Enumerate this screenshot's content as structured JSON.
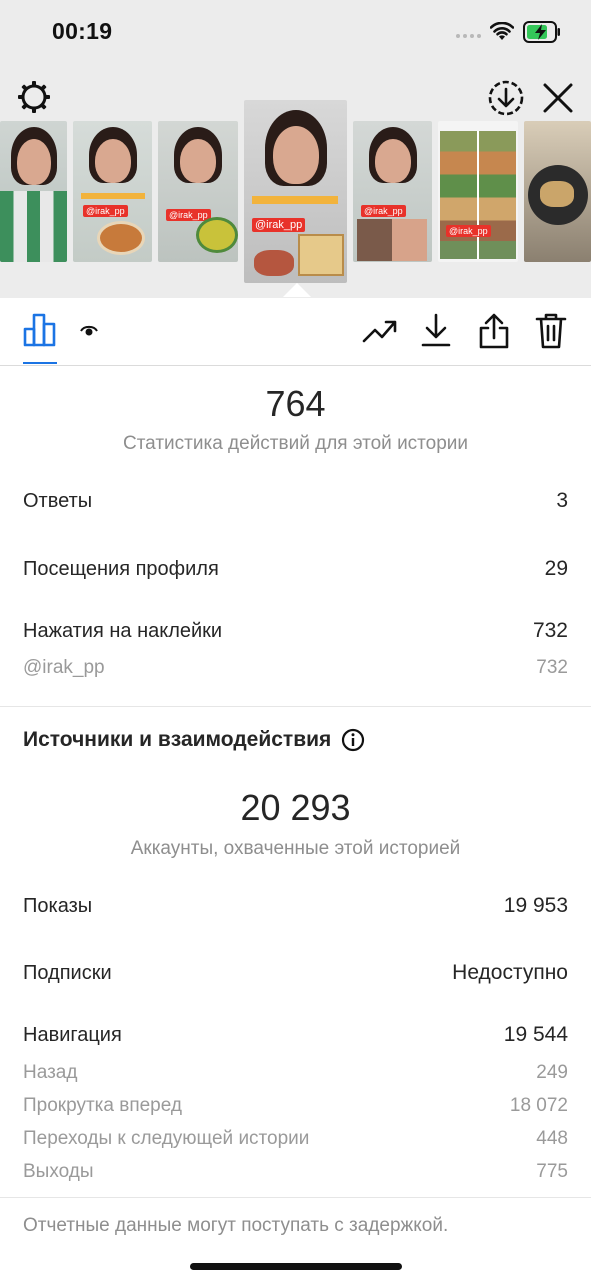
{
  "status_bar": {
    "time": "00:19"
  },
  "icons": {
    "settings": "gear-icon",
    "save": "download-circle-icon",
    "close": "close-icon",
    "insights": "bar-chart-icon",
    "viewers": "eye-icon",
    "promote": "trending-up-icon",
    "download": "download-icon",
    "share": "share-icon",
    "delete": "trash-icon",
    "info": "info-icon"
  },
  "stories": {
    "selected_index": 3,
    "thumbnails": [
      {
        "tag": ""
      },
      {
        "tag": "@irak_pp"
      },
      {
        "tag": "@irak_pp"
      },
      {
        "tag": "@irak_pp"
      },
      {
        "tag": "@irak_pp"
      },
      {
        "tag": "@irak_pp"
      },
      {
        "tag": ""
      }
    ]
  },
  "actions": {
    "total": "764",
    "caption": "Статистика действий для этой истории",
    "rows": [
      {
        "label": "Ответы",
        "value": "3"
      },
      {
        "label": "Посещения профиля",
        "value": "29"
      },
      {
        "label": "Нажатия на наклейки",
        "value": "732"
      }
    ],
    "sticker_breakdown": {
      "label": "@irak_pp",
      "value": "732"
    }
  },
  "discovery": {
    "title": "Источники и взаимодействия",
    "reach": "20 293",
    "reach_caption": "Аккаунты, охваченные этой историей",
    "rows": [
      {
        "label": "Показы",
        "value": "19 953"
      },
      {
        "label": "Подписки",
        "value": "Недоступно"
      },
      {
        "label": "Навигация",
        "value": "19 544"
      }
    ],
    "navigation_breakdown": [
      {
        "label": "Назад",
        "value": "249"
      },
      {
        "label": "Прокрутка вперед",
        "value": "18 072"
      },
      {
        "label": "Переходы к следующей истории",
        "value": "448"
      },
      {
        "label": "Выходы",
        "value": "775"
      }
    ]
  },
  "footer": {
    "note": "Отчетные данные могут поступать с задержкой."
  },
  "colors": {
    "accent": "#1b74e4",
    "sticker_tag": "#e8322a",
    "muted_text": "#8e8e8e"
  }
}
